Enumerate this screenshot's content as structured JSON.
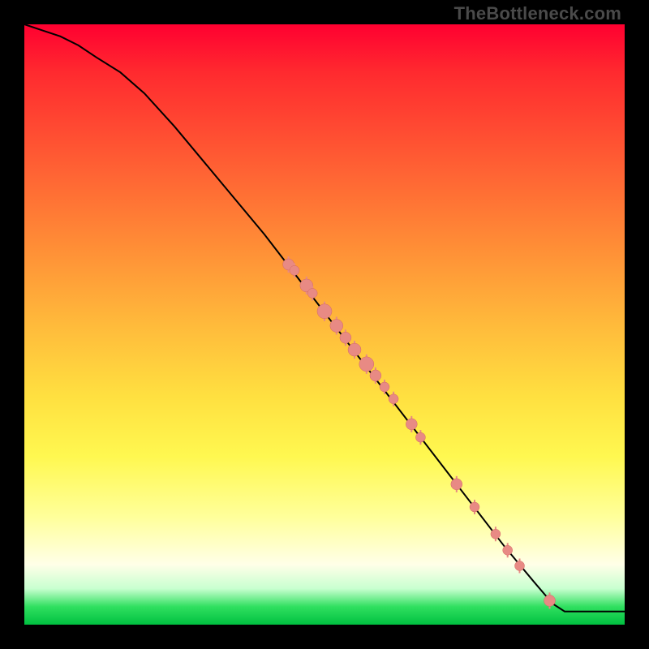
{
  "watermark": "TheBottleneck.com",
  "colors": {
    "frame": "#000000",
    "curve": "#000000",
    "dot_fill": "#e88a84",
    "dot_stroke": "#d46962"
  },
  "chart_data": {
    "type": "line",
    "title": "",
    "xlabel": "",
    "ylabel": "",
    "xlim": [
      0,
      100
    ],
    "ylim": [
      0,
      100
    ],
    "grid": false,
    "legend": false,
    "curve": {
      "name": "bottleneck-curve",
      "x": [
        0,
        3,
        6,
        9,
        12,
        16,
        20,
        25,
        30,
        35,
        40,
        45,
        50,
        55,
        60,
        65,
        70,
        75,
        80,
        85,
        88,
        90,
        100
      ],
      "y": [
        100,
        99,
        98,
        96.5,
        94.5,
        92,
        88.5,
        83,
        77,
        71,
        65,
        58.5,
        52,
        45.5,
        39,
        32.5,
        26,
        19.5,
        13,
        7,
        3.5,
        2.2,
        2.2
      ]
    },
    "scatter": {
      "name": "data-points",
      "points": [
        {
          "x": 44,
          "y": 60,
          "r": 7
        },
        {
          "x": 45,
          "y": 59,
          "r": 6
        },
        {
          "x": 47,
          "y": 56.5,
          "r": 8
        },
        {
          "x": 48,
          "y": 55.2,
          "r": 6
        },
        {
          "x": 50,
          "y": 52.2,
          "r": 9
        },
        {
          "x": 52,
          "y": 49.8,
          "r": 8
        },
        {
          "x": 53.5,
          "y": 47.8,
          "r": 7
        },
        {
          "x": 55,
          "y": 45.8,
          "r": 8
        },
        {
          "x": 57,
          "y": 43.4,
          "r": 9
        },
        {
          "x": 58.5,
          "y": 41.5,
          "r": 7
        },
        {
          "x": 60,
          "y": 39.6,
          "r": 6
        },
        {
          "x": 61.5,
          "y": 37.6,
          "r": 6
        },
        {
          "x": 64.5,
          "y": 33.4,
          "r": 7
        },
        {
          "x": 66,
          "y": 31.2,
          "r": 6
        },
        {
          "x": 72,
          "y": 23.4,
          "r": 7
        },
        {
          "x": 75,
          "y": 19.6,
          "r": 6
        },
        {
          "x": 78.5,
          "y": 15.1,
          "r": 6
        },
        {
          "x": 80.5,
          "y": 12.4,
          "r": 6
        },
        {
          "x": 82.5,
          "y": 9.8,
          "r": 6
        },
        {
          "x": 87.5,
          "y": 4.0,
          "r": 7
        }
      ]
    }
  }
}
